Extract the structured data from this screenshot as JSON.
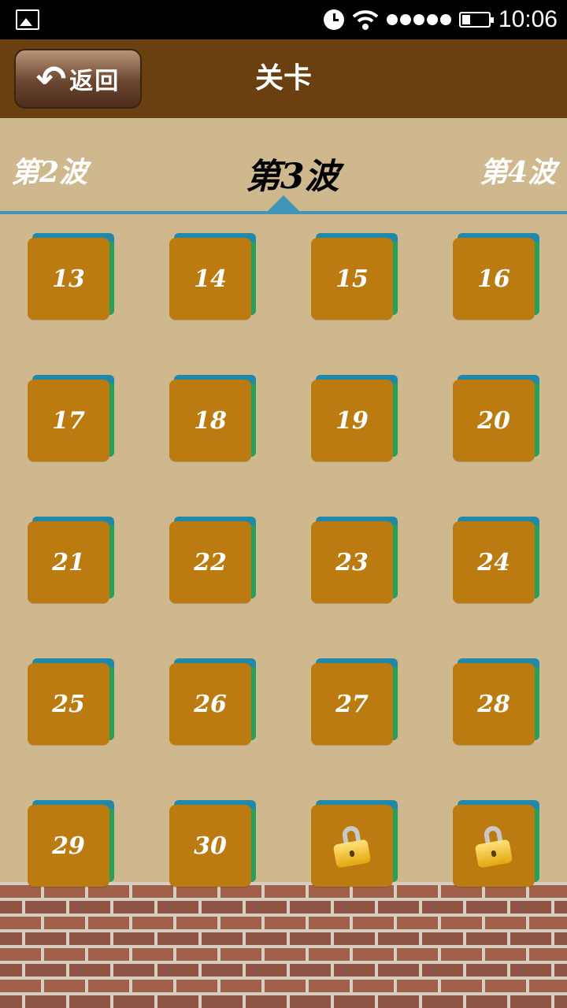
{
  "status_bar": {
    "time": "10:06"
  },
  "header": {
    "back_label": "返回",
    "back_arrow": "↶",
    "title": "关卡"
  },
  "waves": {
    "prev": "第2波",
    "current": "第3波",
    "next": "第4波"
  },
  "levels": [
    {
      "label": "13",
      "locked": false
    },
    {
      "label": "14",
      "locked": false
    },
    {
      "label": "15",
      "locked": false
    },
    {
      "label": "16",
      "locked": false
    },
    {
      "label": "17",
      "locked": false
    },
    {
      "label": "18",
      "locked": false
    },
    {
      "label": "19",
      "locked": false
    },
    {
      "label": "20",
      "locked": false
    },
    {
      "label": "21",
      "locked": false
    },
    {
      "label": "22",
      "locked": false
    },
    {
      "label": "23",
      "locked": false
    },
    {
      "label": "24",
      "locked": false
    },
    {
      "label": "25",
      "locked": false
    },
    {
      "label": "26",
      "locked": false
    },
    {
      "label": "27",
      "locked": false
    },
    {
      "label": "28",
      "locked": false
    },
    {
      "label": "29",
      "locked": false
    },
    {
      "label": "30",
      "locked": false
    },
    {
      "label": "",
      "locked": true
    },
    {
      "label": "",
      "locked": true
    }
  ],
  "colors": {
    "header": "#6a4010",
    "background": "#cfb88e",
    "tile": "#bb7b10",
    "tile_back": "#2088a8",
    "wave_line": "#3f95b5"
  }
}
